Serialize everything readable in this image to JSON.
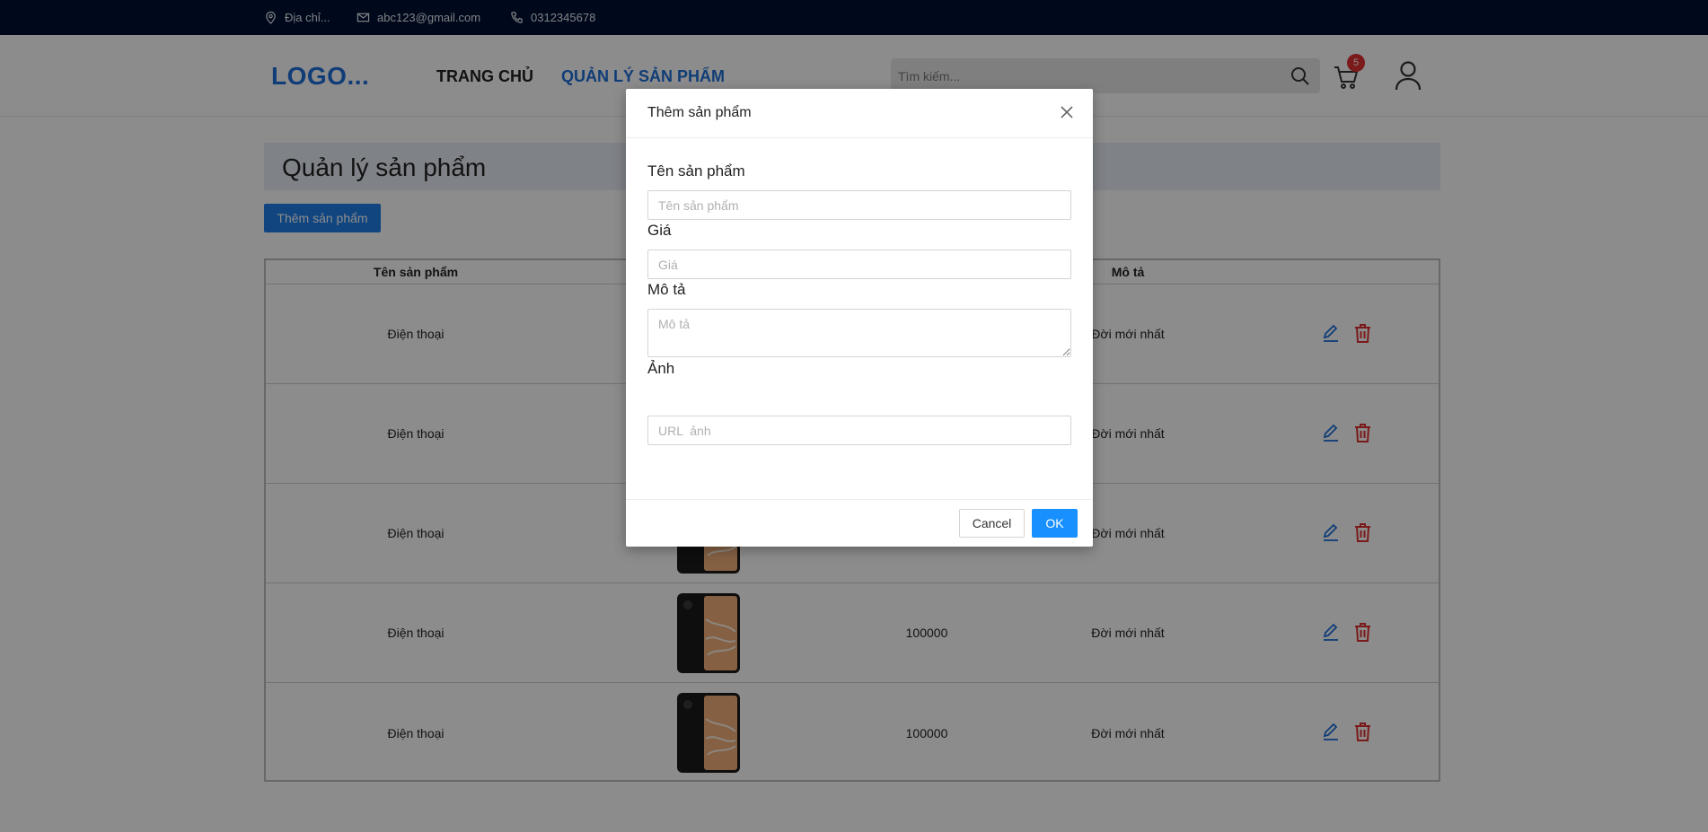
{
  "topbar": {
    "address": "Địa chỉ...",
    "email": "abc123@gmail.com",
    "phone": "0312345678"
  },
  "header": {
    "logo": "LOGO...",
    "nav": [
      {
        "label": "TRANG CHỦ",
        "active": false
      },
      {
        "label": "QUẢN LÝ SẢN PHẨM",
        "active": true
      }
    ],
    "search_placeholder": "Tìm kiếm...",
    "cart_count": "5"
  },
  "main": {
    "page_title": "Quản lý sản phẩm",
    "add_button": "Thêm sản phẩm",
    "table": {
      "columns": [
        "Tên sản phẩm",
        "Mô tả"
      ],
      "rows": [
        {
          "name": "Điện thoại",
          "price": "",
          "description": "Đời mới nhất"
        },
        {
          "name": "Điện thoại",
          "price": "",
          "description": "Đời mới nhất"
        },
        {
          "name": "Điện thoại",
          "price": "",
          "description": "Đời mới nhất"
        },
        {
          "name": "Điện thoại",
          "price": "100000",
          "description": "Đời mới nhất"
        },
        {
          "name": "Điện thoại",
          "price": "100000",
          "description": "Đời mới nhất"
        }
      ]
    }
  },
  "modal": {
    "title": "Thêm sản phẩm",
    "fields": {
      "name": {
        "label": "Tên sản phẩm",
        "placeholder": "Tên sản phẩm"
      },
      "price": {
        "label": "Giá",
        "placeholder": "Giá"
      },
      "description": {
        "label": "Mô tả",
        "placeholder": "Mô tả"
      },
      "image": {
        "label": "Ảnh",
        "placeholder": "URL  ảnh"
      }
    },
    "cancel_label": "Cancel",
    "ok_label": "OK"
  },
  "colors": {
    "topbar_bg": "#001233",
    "accent": "#1e6fd9",
    "primary_button": "#1890ff",
    "delete": "#e03131"
  }
}
